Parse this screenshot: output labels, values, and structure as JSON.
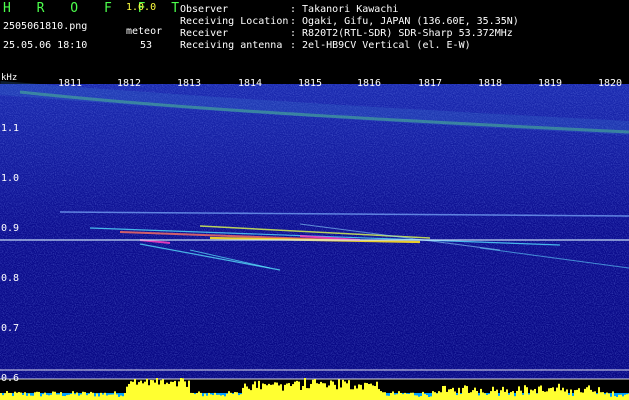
{
  "header": {
    "title": "H R O F F T",
    "version": "1.0.0",
    "filename": "2505061810.png",
    "meteor_label": "meteor",
    "timestamp": "25.05.06 18:10",
    "meteor_count": "53"
  },
  "info": {
    "observer_label": "Observer",
    "observer_value": ": Takanori Kawachi",
    "location_label": "Receiving Location",
    "location_value": ": Ogaki, Gifu, JAPAN (136.60E, 35.35N)",
    "receiver_label": "Receiver",
    "receiver_value": ": R820T2(RTL-SDR) SDR-Sharp 53.372MHz",
    "antenna_label": "Receiving antenna",
    "antenna_value": ": 2el-HB9CV Vertical (el. E-W)"
  },
  "axis": {
    "y_unit": "kHz",
    "x_ticks": [
      "1811",
      "1812",
      "1813",
      "1814",
      "1815",
      "1816",
      "1817",
      "1818",
      "1819",
      "1820"
    ],
    "y_ticks": [
      "1.1",
      "1.0",
      "0.9",
      "0.8",
      "0.7",
      "0.6"
    ]
  },
  "colors": {
    "background": "#000000",
    "spectrogram_base": "#0a0a8c",
    "title_green": "#4cff4c",
    "version_yellow": "#ffff40",
    "level_bar": "#ffff30",
    "level_base": "#00a0ff"
  }
}
